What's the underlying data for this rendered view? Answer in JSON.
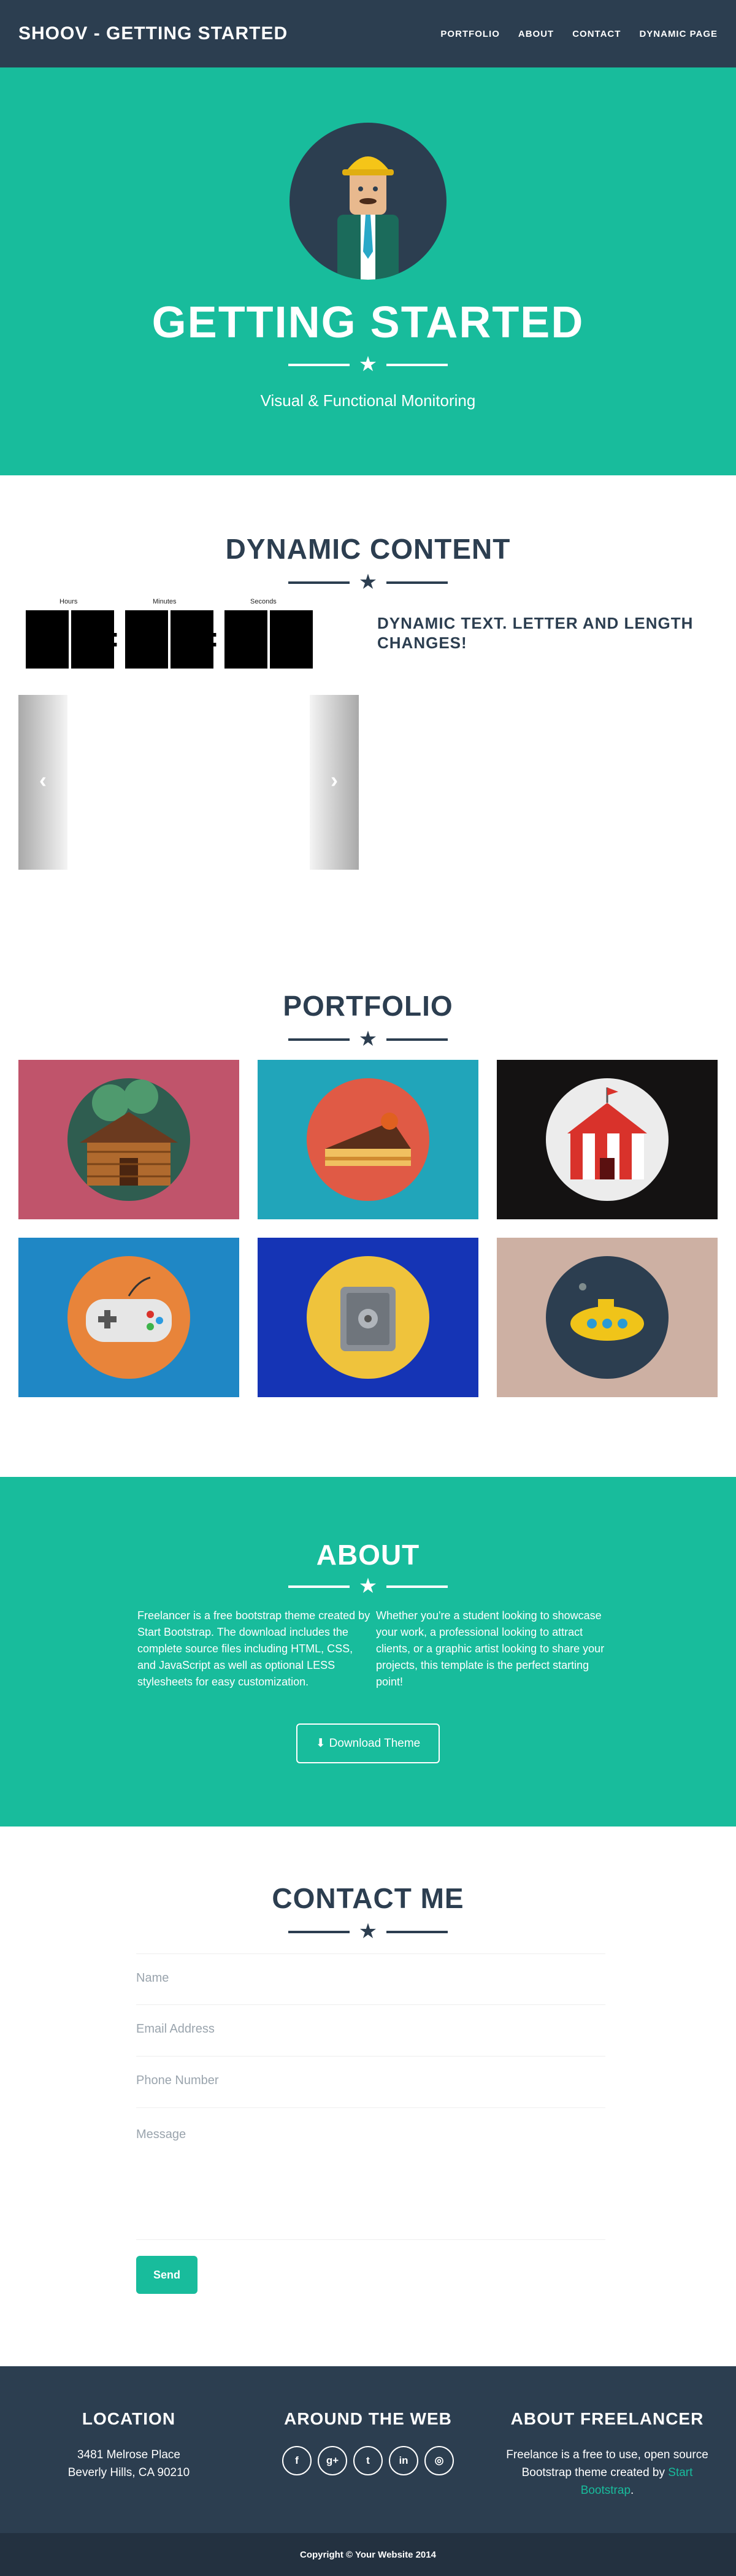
{
  "nav": {
    "brand": "SHOOV - GETTING STARTED",
    "links": [
      "PORTFOLIO",
      "ABOUT",
      "CONTACT",
      "DYNAMIC PAGE"
    ]
  },
  "hero": {
    "title": "GETTING STARTED",
    "subtitle": "Visual & Functional Monitoring"
  },
  "dynamic": {
    "title": "DYNAMIC CONTENT",
    "countdown_labels": [
      "Hours",
      "Minutes",
      "Seconds"
    ],
    "text": "DYNAMIC TEXT. LETTER AND LENGTH CHANGES!",
    "prev_arrow": "‹",
    "next_arrow": "›"
  },
  "portfolio": {
    "title": "PORTFOLIO",
    "items": [
      {
        "icon": "cabin-icon",
        "bg": "#c0546b"
      },
      {
        "icon": "cake-icon",
        "bg": "#21a5ba"
      },
      {
        "icon": "circus-tent-icon",
        "bg": "#141212"
      },
      {
        "icon": "game-controller-icon",
        "bg": "#1f87c5"
      },
      {
        "icon": "safe-icon",
        "bg": "#1534b5"
      },
      {
        "icon": "submarine-icon",
        "bg": "#cdb0a3"
      }
    ]
  },
  "about": {
    "title": "ABOUT",
    "col1": "Freelancer is a free bootstrap theme created by Start Bootstrap. The download includes the complete source files including HTML, CSS, and JavaScript as well as optional LESS stylesheets for easy customization.",
    "col2": "Whether you're a student looking to showcase your work, a professional looking to attract clients, or a graphic artist looking to share your projects, this template is the perfect starting point!",
    "button": "Download Theme"
  },
  "contact": {
    "title": "CONTACT ME",
    "fields": {
      "name": "Name",
      "email": "Email Address",
      "phone": "Phone Number",
      "message": "Message"
    },
    "send": "Send"
  },
  "footer": {
    "location_title": "LOCATION",
    "address_line1": "3481 Melrose Place",
    "address_line2": "Beverly Hills, CA 90210",
    "web_title": "AROUND THE WEB",
    "social": [
      "f",
      "g+",
      "t",
      "in",
      "◎"
    ],
    "about_title": "ABOUT FREELANCER",
    "about_text": "Freelance is a free to use, open source Bootstrap theme created by",
    "about_link": "Start Bootstrap",
    "about_end": ".",
    "copyright": "Copyright © Your Website 2014"
  },
  "colors": {
    "primary": "#2c3e50",
    "accent": "#18bc9c"
  }
}
